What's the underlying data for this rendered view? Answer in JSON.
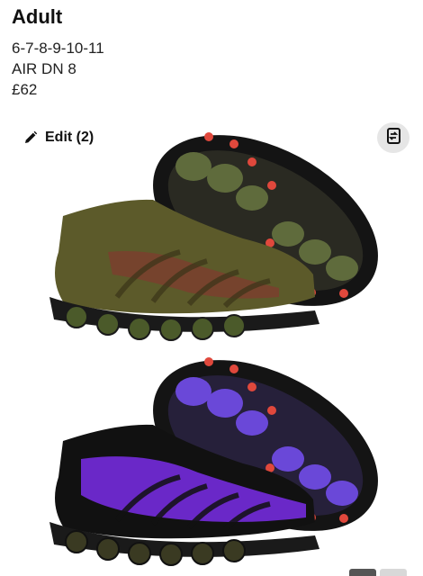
{
  "listing": {
    "title": "Adult",
    "sizes": "6-7-8-9-10-11",
    "model": "AIR DN 8",
    "price": "£62"
  },
  "photo": {
    "edit_label": "Edit (2)",
    "icons": {
      "edit": "pencil-icon",
      "swap": "swap-icon"
    },
    "colors": {
      "shoe1_upper": "#5c5a2a",
      "shoe1_accent": "#7a3f2e",
      "shoe2_upper": "#6a28c8",
      "sole": "#1a1a1a",
      "pods_olive": "#5f6b3c",
      "pods_purple": "#6a48d8",
      "studs": "#e0483c"
    }
  }
}
